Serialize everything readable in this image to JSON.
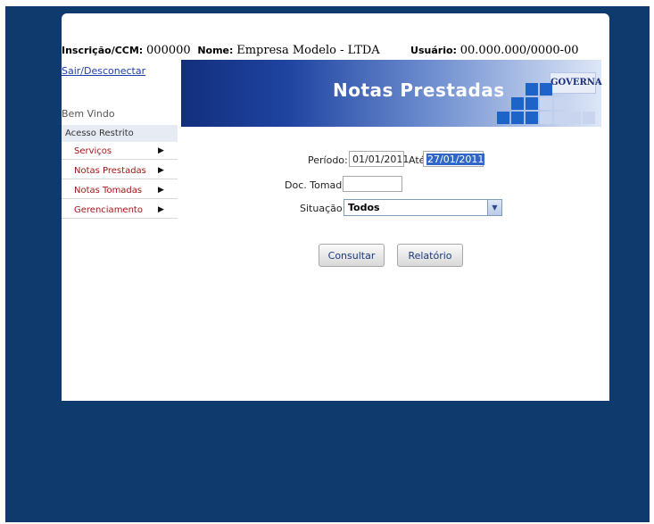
{
  "header": {
    "inscricao_label": "Inscrição/CCM:",
    "inscricao_value": "000000",
    "nome_label": "Nome:",
    "nome_value": "Empresa Modelo - LTDA",
    "usuario_label": "Usuário:",
    "usuario_value": "00.000.000/0000-00",
    "logout_link": "Sair/Desconectar"
  },
  "banner": {
    "title": "Notas Prestadas",
    "logo_text": "GOVERNA"
  },
  "sidebar": {
    "welcome": "Bem Vindo",
    "section": "Acesso Restrito",
    "items": [
      {
        "label": "Serviços"
      },
      {
        "label": "Notas Prestadas"
      },
      {
        "label": "Notas Tomadas"
      },
      {
        "label": "Gerenciamento"
      }
    ],
    "arrow_glyph": "▶"
  },
  "form": {
    "periodo_label": "Período:",
    "periodo_value": "01/01/2011",
    "ate_label": "Até:",
    "ate_value": "27/01/2011",
    "doc_tomador_label": "Doc. Tomador:",
    "doc_tomador_value": "",
    "situacao_label": "Situação:",
    "situacao_value": "Todos",
    "dropdown_glyph": "▼"
  },
  "buttons": {
    "consultar": "Consultar",
    "relatorio": "Relatório"
  },
  "colors": {
    "background": "#0e3a6e",
    "accent": "#1e43a0",
    "menu_text": "#a01818"
  }
}
